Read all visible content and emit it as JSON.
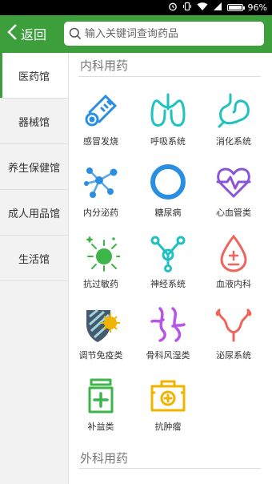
{
  "status_bar": {
    "battery": "96%"
  },
  "header": {
    "back_label": "返回",
    "search_placeholder": "输入关键词查询药品"
  },
  "sidebar": {
    "items": [
      {
        "label": "医药馆"
      },
      {
        "label": "器械馆"
      },
      {
        "label": "养生保健馆"
      },
      {
        "label": "成人用品馆"
      },
      {
        "label": "生活馆"
      }
    ]
  },
  "sections": [
    {
      "title": "内科用药",
      "items": [
        {
          "label": "感冒发烧",
          "icon": "thermometer-icon"
        },
        {
          "label": "呼吸系统",
          "icon": "lungs-icon"
        },
        {
          "label": "消化系统",
          "icon": "stomach-icon"
        },
        {
          "label": "内分泌药",
          "icon": "molecule-icon"
        },
        {
          "label": "糖尿病",
          "icon": "ring-icon"
        },
        {
          "label": "心血管类",
          "icon": "heart-pulse-icon"
        },
        {
          "label": "抗过敏药",
          "icon": "allergen-icon"
        },
        {
          "label": "神经系统",
          "icon": "neuron-icon"
        },
        {
          "label": "血液内科",
          "icon": "blood-drop-icon"
        },
        {
          "label": "调节免疫类",
          "icon": "shield-icon"
        },
        {
          "label": "骨科风湿类",
          "icon": "bones-icon"
        },
        {
          "label": "泌尿系统",
          "icon": "urinary-icon"
        },
        {
          "label": "补益类",
          "icon": "bottle-plus-icon"
        },
        {
          "label": "抗肿瘤",
          "icon": "medkit-icon"
        }
      ]
    },
    {
      "title": "外科用药"
    }
  ],
  "colors": {
    "brand_green": "#3d9e3c",
    "icon_blue": "#2a8fe0",
    "icon_teal": "#1fc1c1",
    "icon_purple": "#8b53d6",
    "icon_red": "#f0625a",
    "icon_green": "#3db54a",
    "icon_orange": "#f0b400"
  }
}
